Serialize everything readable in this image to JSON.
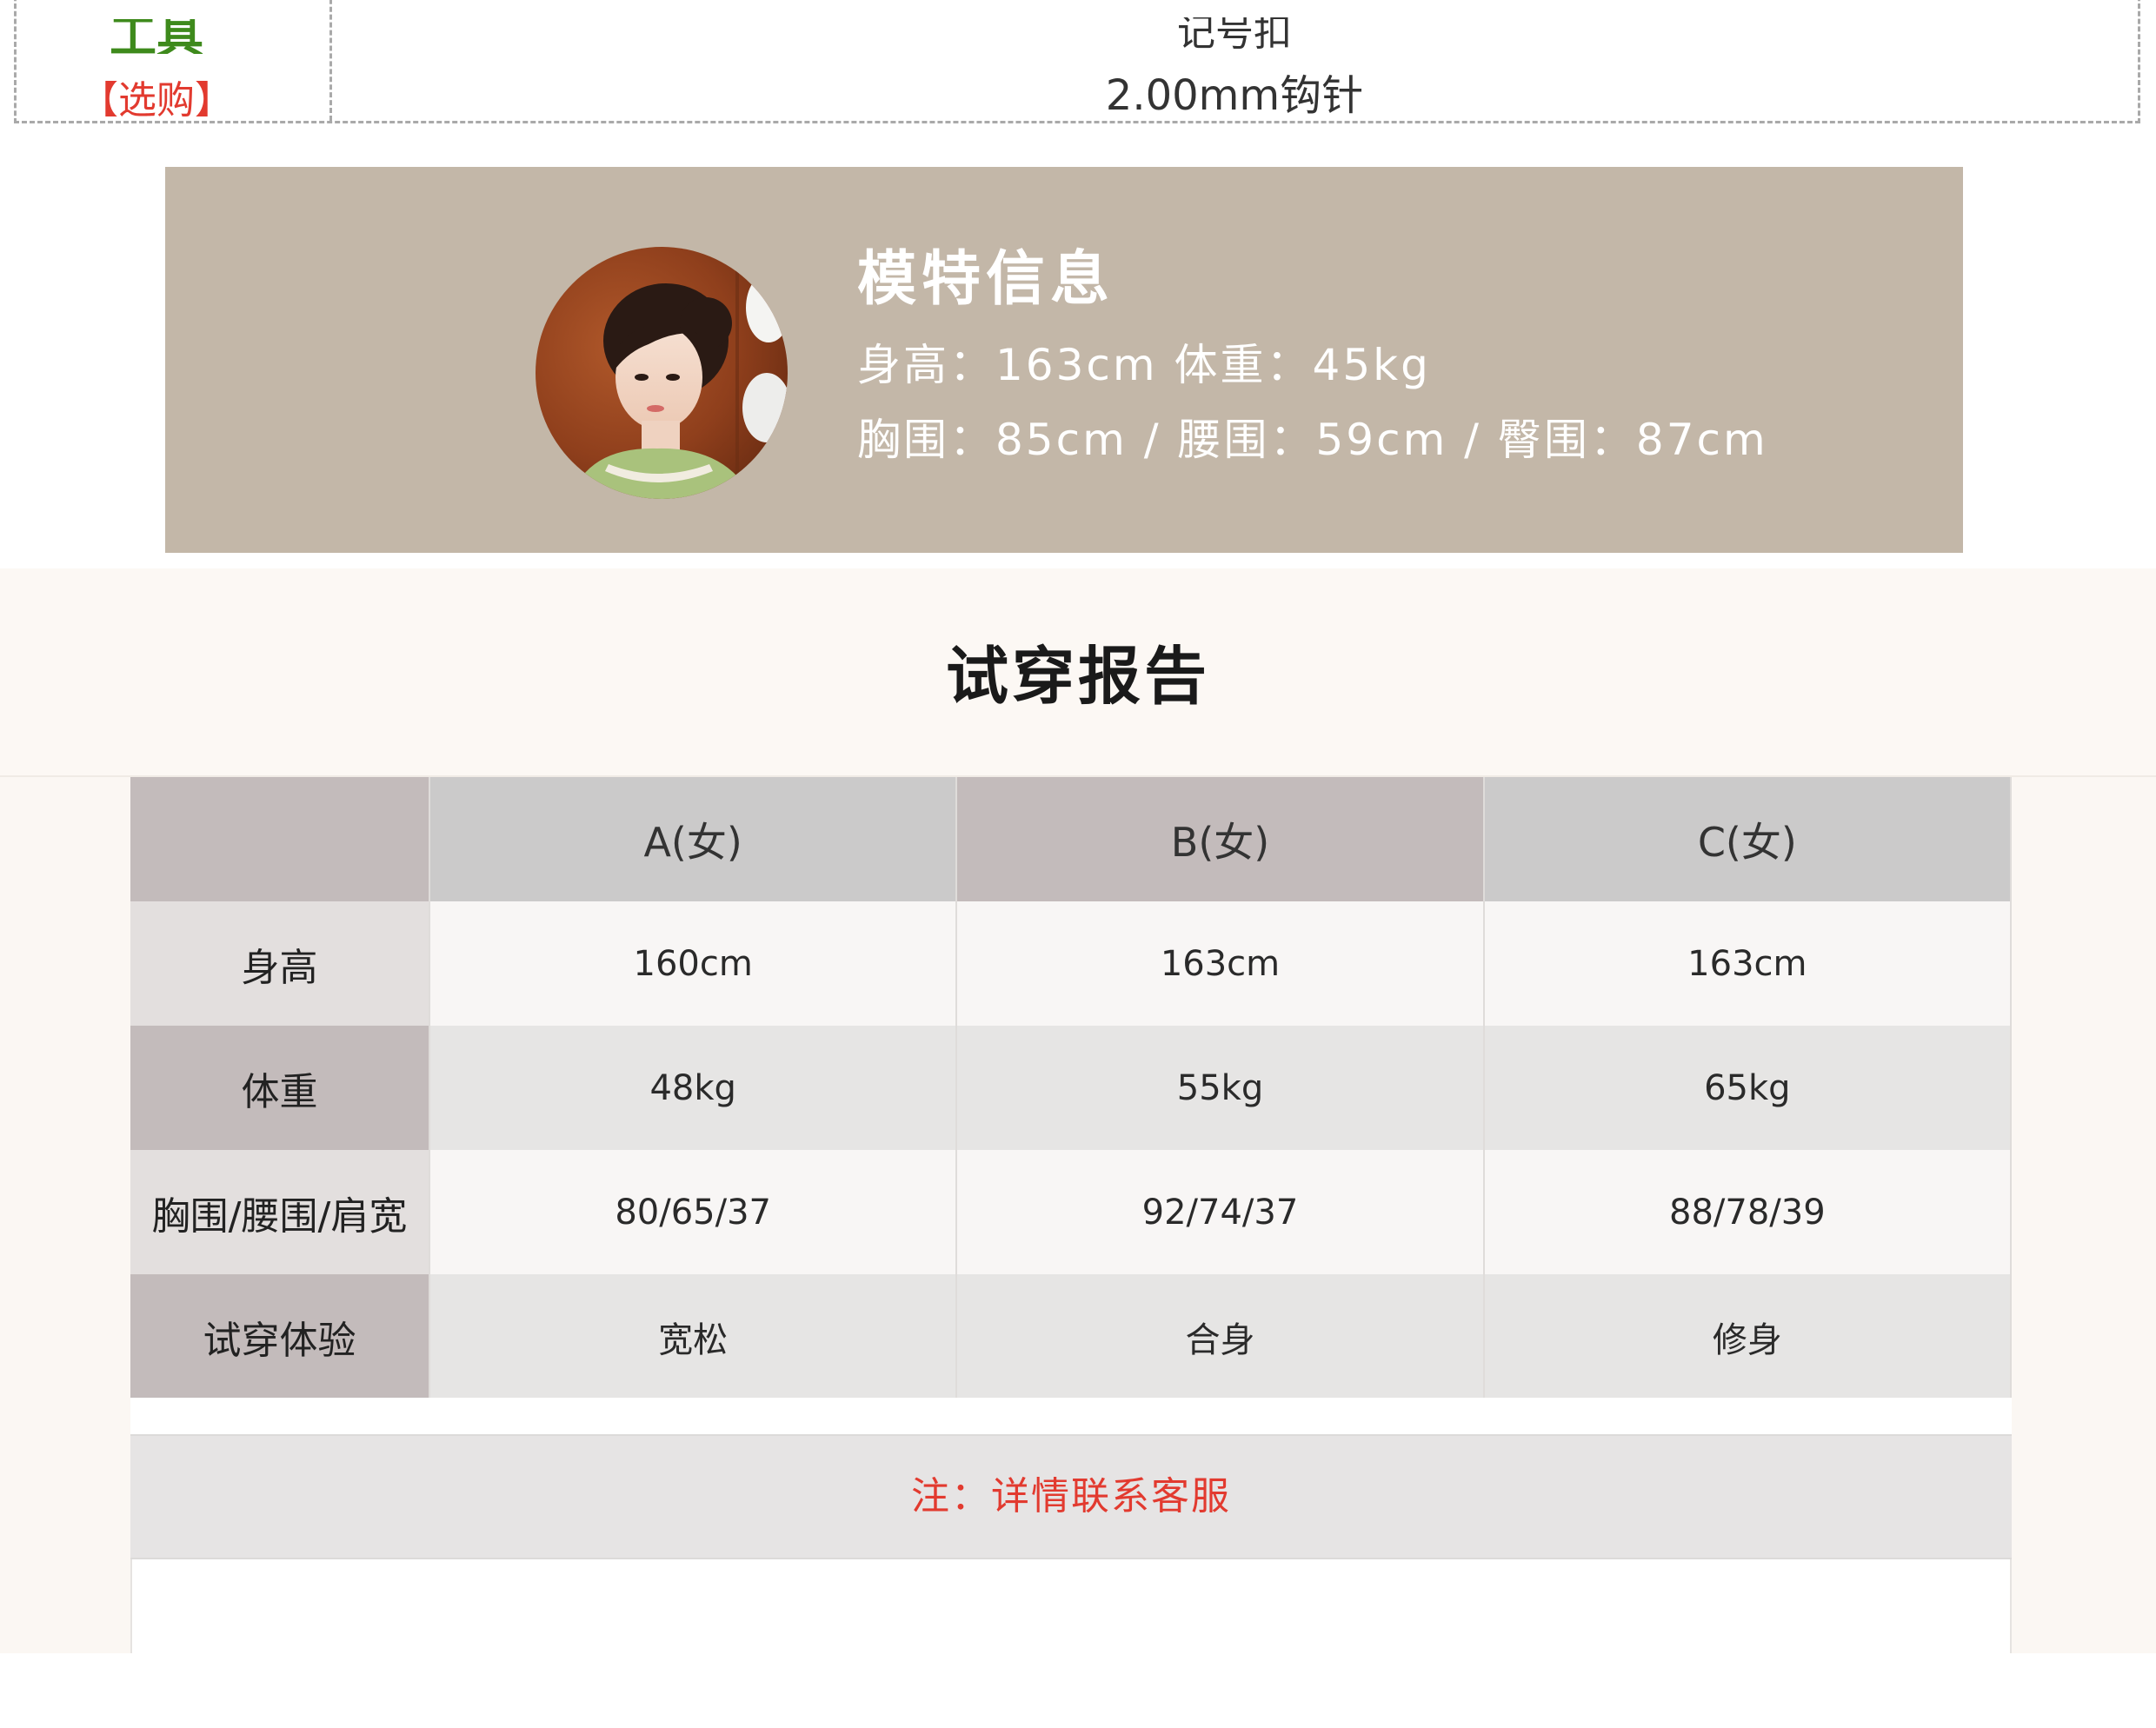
{
  "tools": {
    "title": "工具",
    "buy_label": "【选购】",
    "line1": "记号扣",
    "line2": "2.00mm钩针"
  },
  "model": {
    "title": "模特信息",
    "line1": "身高：163cm  体重：45kg",
    "line2": "胸围：85cm / 腰围：59cm / 臀围：87cm"
  },
  "report": {
    "title": "试穿报告",
    "columns": [
      "",
      "A(女)",
      "B(女)",
      "C(女)"
    ],
    "rows": [
      {
        "label": "身高",
        "values": [
          "160cm",
          "163cm",
          "163cm"
        ]
      },
      {
        "label": "体重",
        "values": [
          "48kg",
          "55kg",
          "65kg"
        ]
      },
      {
        "label": "胸围/腰围/肩宽",
        "values": [
          "80/65/37",
          "92/74/37",
          "88/78/39"
        ]
      },
      {
        "label": "试穿体验",
        "values": [
          "宽松",
          "合身",
          "修身"
        ]
      }
    ],
    "note": "注：详情联系客服"
  },
  "colors": {
    "tools_title": "#3e8a1c",
    "accent_red": "#e23a2f",
    "banner": "#c3b7a8",
    "report_bg": "#fbf7f3"
  }
}
